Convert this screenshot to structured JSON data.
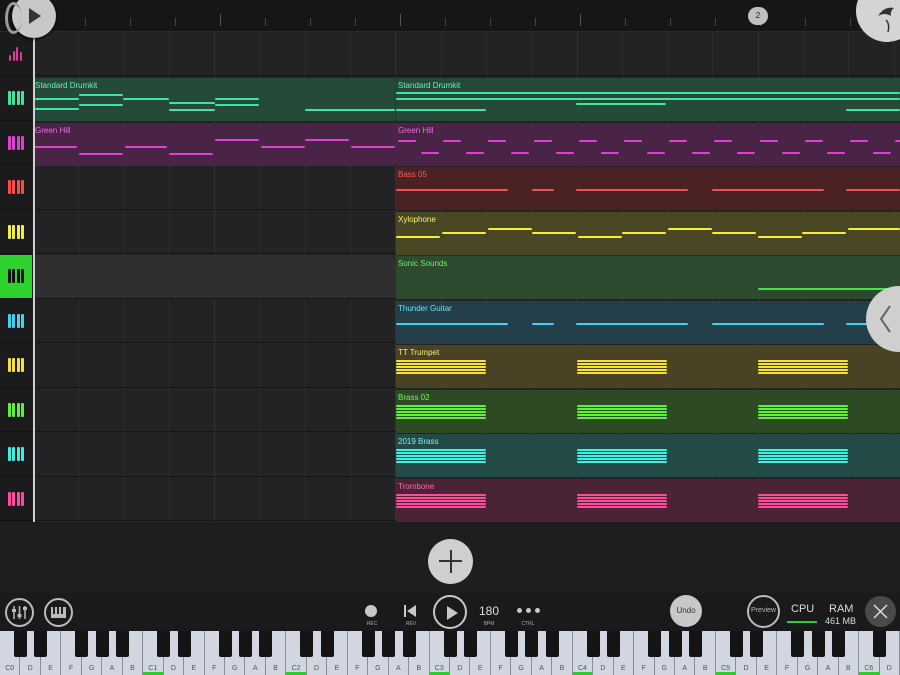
{
  "ruler": {
    "bar_marker": "2"
  },
  "tracks": [
    {
      "icon": "drum-icon",
      "color": "#e0389a",
      "selected": false
    },
    {
      "icon": "keyboard-icon",
      "color": "#3ee6a0",
      "selected": false
    },
    {
      "icon": "keyboard-icon",
      "color": "#e040d0",
      "selected": false
    },
    {
      "icon": "keyboard-icon",
      "color": "#ff4a4a",
      "selected": false
    },
    {
      "icon": "keyboard-icon",
      "color": "#f2ef3a",
      "selected": false
    },
    {
      "icon": "keyboard-icon",
      "color": "#111111",
      "selected": true
    },
    {
      "icon": "keyboard-icon",
      "color": "#3cd4f0",
      "selected": false
    },
    {
      "icon": "keyboard-icon",
      "color": "#f6e040",
      "selected": false
    },
    {
      "icon": "keyboard-icon",
      "color": "#5ff03c",
      "selected": false
    },
    {
      "icon": "keyboard-icon",
      "color": "#3cf0e4",
      "selected": false
    },
    {
      "icon": "keyboard-icon",
      "color": "#ff4aa0",
      "selected": false
    }
  ],
  "clips": {
    "row1_a": "Standard Drumkit",
    "row1_b": "Standard Drumkit",
    "row2_a": "Green Hill",
    "row2_b": "Green Hill",
    "row3": "Bass 05",
    "row4": "Xylophone",
    "row5": "Sonic Sounds",
    "row6": "Thunder Guitar",
    "row7": "TT Trumpet",
    "row8": "Brass 02",
    "row9": "2019 Brass",
    "row10": "Trombone"
  },
  "transport": {
    "rec_label": "REC",
    "rev_label": "REV",
    "bpm_value": "180",
    "bpm_label": "BPM",
    "ctrl_label": "CTRL",
    "undo_label": "Undo",
    "preview_label": "Preview",
    "cpu_label": "CPU",
    "ram_label": "RAM",
    "ram_value": "461 MB"
  },
  "piano": {
    "white_keys": [
      "C0",
      "D",
      "E",
      "F",
      "G",
      "A",
      "B",
      "C1",
      "D",
      "E",
      "F",
      "G",
      "A",
      "B",
      "C2",
      "D",
      "E",
      "F",
      "G",
      "A",
      "B",
      "C3",
      "D",
      "E",
      "F",
      "G",
      "A",
      "B",
      "C4",
      "D",
      "E",
      "F",
      "G",
      "A",
      "B",
      "C5",
      "D",
      "E",
      "F",
      "G",
      "A",
      "B",
      "C6",
      "D"
    ],
    "highlighted": [
      "C1",
      "C2",
      "C3",
      "C4",
      "C5",
      "C6"
    ]
  }
}
